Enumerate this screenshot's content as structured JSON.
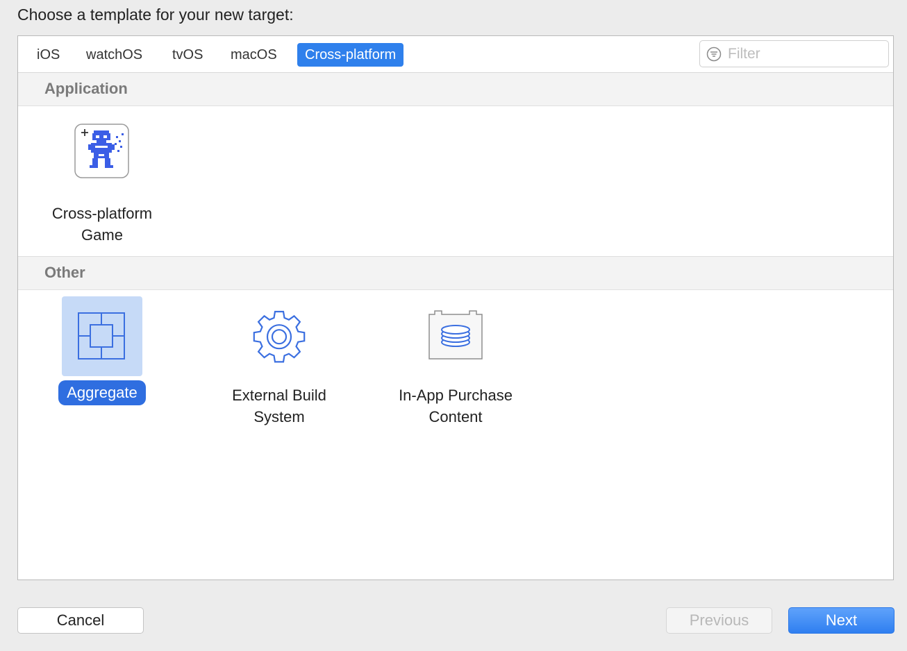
{
  "dialog": {
    "heading": "Choose a template for your new target:"
  },
  "tabs": [
    {
      "label": "iOS",
      "selected": false
    },
    {
      "label": "watchOS",
      "selected": false
    },
    {
      "label": "tvOS",
      "selected": false
    },
    {
      "label": "macOS",
      "selected": false
    },
    {
      "label": "Cross-platform",
      "selected": true
    }
  ],
  "filter": {
    "placeholder": "Filter",
    "value": ""
  },
  "sections": [
    {
      "title": "Application",
      "templates": [
        {
          "label": "Cross-platform\nGame",
          "icon": "game-robot-icon",
          "selected": false
        }
      ]
    },
    {
      "title": "Other",
      "templates": [
        {
          "label": "Aggregate",
          "icon": "aggregate-icon",
          "selected": true
        },
        {
          "label": "External Build\nSystem",
          "icon": "gear-icon",
          "selected": false
        },
        {
          "label": "In-App Purchase\nContent",
          "icon": "coin-stack-box-icon",
          "selected": false
        }
      ]
    }
  ],
  "buttons": {
    "cancel": "Cancel",
    "previous": "Previous",
    "next": "Next"
  },
  "colors": {
    "accent": "#2f80ec",
    "icon_blue": "#3b6fe0"
  }
}
